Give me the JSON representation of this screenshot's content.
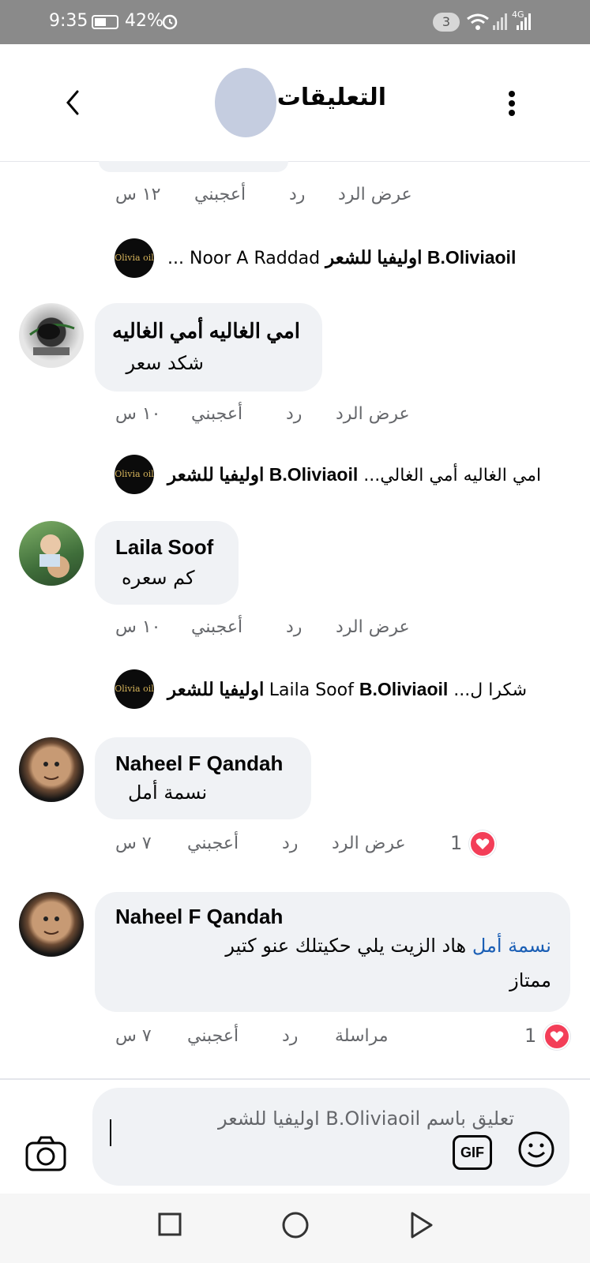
{
  "status_bar": {
    "time": "9:35",
    "battery": "42%",
    "notif_count": "3",
    "network": "4G"
  },
  "header": {
    "title": "التعليقات"
  },
  "top_meta": {
    "view_reply": "عرض الرد",
    "reply": "رد",
    "like": "أعجبني",
    "time": "١٢ س"
  },
  "reply_preview_1": {
    "page_name": "B.Oliviaoil اوليفيا للشعر",
    "snippet": "Noor A Raddad ..."
  },
  "comments": [
    {
      "name": "امي الغاليه أمي الغاليه",
      "text": "شكد سعر",
      "view_reply": "عرض الرد",
      "reply": "رد",
      "like": "أعجبني",
      "time": "١٠ س",
      "reply_preview": {
        "page_name": "B.Oliviaoil اوليفيا للشعر",
        "snippet": "امي الغاليه أمي الغالي..."
      }
    },
    {
      "name": "Laila Soof",
      "text": "كم سعره",
      "view_reply": "عرض الرد",
      "reply": "رد",
      "like": "أعجبني",
      "time": "١٠ س",
      "reply_preview": {
        "page_name": "B.Oliviaoil اوليفيا للشعر",
        "snippet": "شكرا ل... Laila Soof"
      }
    },
    {
      "name": "Naheel F Qandah",
      "mention": "نسمة أمل",
      "view_reply": "عرض الرد",
      "reply": "رد",
      "like": "أعجبني",
      "time": "٧ س",
      "reaction_count": "1"
    },
    {
      "name": "Naheel F Qandah",
      "mention": "نسمة أمل",
      "text_line1": "هاد الزيت يلي حكيتلك عنو كتير",
      "text_line2": "ممتاز",
      "message": "مراسلة",
      "reply": "رد",
      "like": "أعجبني",
      "time": "٧ س",
      "reaction_count": "1"
    }
  ],
  "composer": {
    "placeholder": "تعليق باسم B.Oliviaoil اوليفيا للشعر",
    "gif_label": "GIF"
  },
  "logo_text": "Olivia oil",
  "colors": {
    "accent": "#1b5fb5",
    "bubble": "#f0f2f5",
    "heart": "#f33e58",
    "status_bar": "#8a8a8a"
  }
}
